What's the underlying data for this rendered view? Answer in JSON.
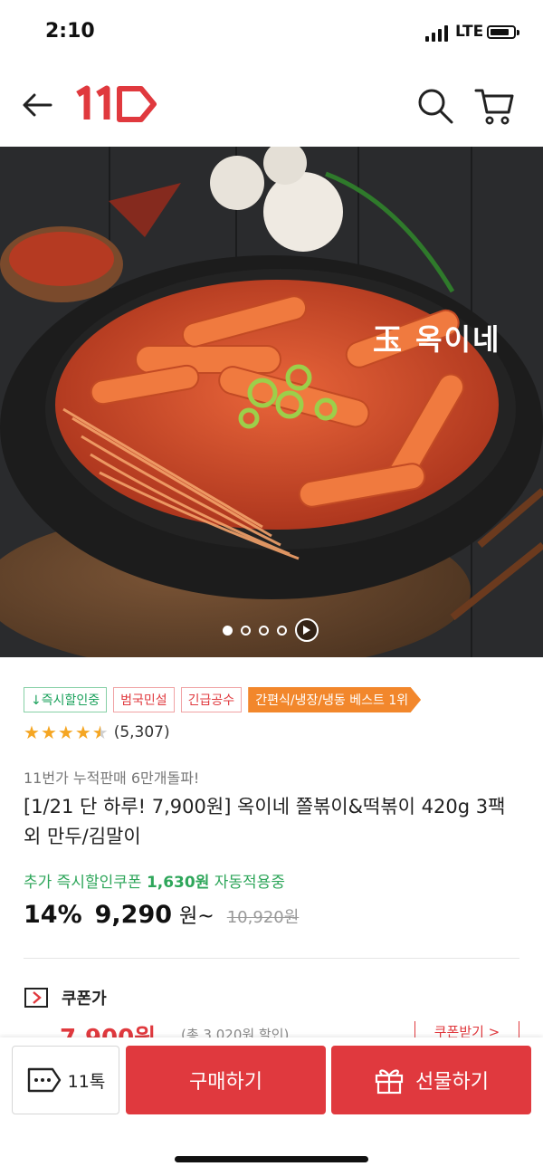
{
  "status_bar": {
    "time": "2:10",
    "network": "LTE"
  },
  "header": {
    "back_icon": "arrow-left-icon",
    "logo_text": "11",
    "search_icon": "search-icon",
    "cart_icon": "cart-icon",
    "brand_color": "#e0393e"
  },
  "hero": {
    "brand_watermark": "玉 옥이네",
    "slide_count": 4,
    "active_slide": 1
  },
  "tags": [
    {
      "label": "↓즉시할인중",
      "style": "green"
    },
    {
      "label": "범국민설",
      "style": "red"
    },
    {
      "label": "긴급공수",
      "style": "red"
    },
    {
      "label": "간편식/냉장/냉동 베스트 1위",
      "style": "best"
    }
  ],
  "rating": {
    "stars": 4.5,
    "count": "(5,307)"
  },
  "product": {
    "promo": "11번가 누적판매 6만개돌파!",
    "title": "[1/21 단 하루! 7,900원] 옥이네 쫄볶이&떡볶이 420g 3팩 외 만두/김말이",
    "coupon_prefix": "추가 즉시할인쿠폰",
    "coupon_amount": "1,630원",
    "coupon_suffix": "자동적용중",
    "discount": "14%",
    "price": "9,290",
    "price_unit": "원~",
    "original_price": "10,920원"
  },
  "coupon_section": {
    "label": "쿠폰가",
    "price_peek": "7,900원",
    "note_peek": "(총 3,020원 할인)",
    "button": "쿠폰받기 >"
  },
  "bottom_bar": {
    "talk_label": "11톡",
    "buy_label": "구매하기",
    "gift_label": "선물하기"
  }
}
